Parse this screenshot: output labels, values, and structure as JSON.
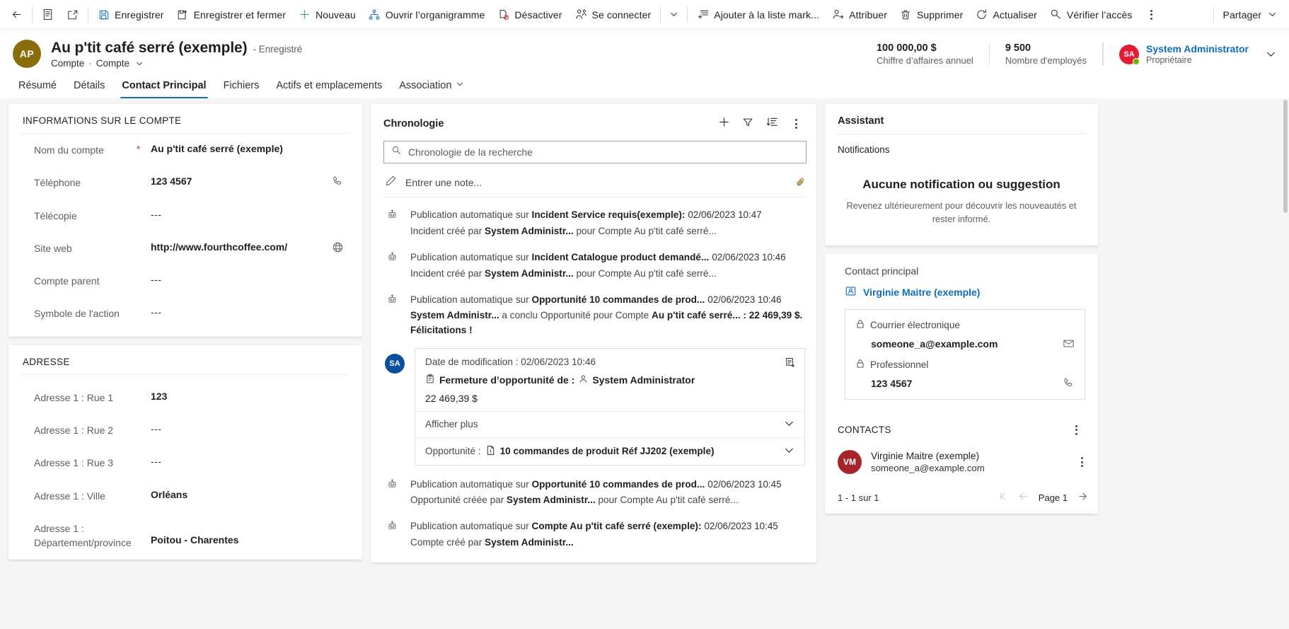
{
  "commandbar": {
    "back_label": "Retour",
    "form_selector_label": "Sélecteur de formulaire",
    "popout_label": "Ouvrir dans une nouvelle fenêtre",
    "items": [
      {
        "label": "Enregistrer",
        "icon": "save-icon"
      },
      {
        "label": "Enregistrer et fermer",
        "icon": "save-and-close-icon"
      },
      {
        "label": "Nouveau",
        "icon": "plus-icon"
      },
      {
        "label": "Ouvrir l’organigramme",
        "icon": "org-chart-icon"
      },
      {
        "label": "Désactiver",
        "icon": "deactivate-icon"
      },
      {
        "label": "Se connecter",
        "icon": "connect-icon"
      },
      {
        "label": "Ajouter à la liste mark...",
        "icon": "add-to-marketing-list-icon"
      },
      {
        "label": "Attribuer",
        "icon": "assign-icon"
      },
      {
        "label": "Supprimer",
        "icon": "delete-icon"
      },
      {
        "label": "Actualiser",
        "icon": "refresh-icon"
      },
      {
        "label": "Vérifier l’accès",
        "icon": "check-access-icon"
      }
    ],
    "overflow_label": "Plus de commandes",
    "share_label": "Partager"
  },
  "record": {
    "avatar_initials": "AP",
    "title": "Au p'tit café serré (exemple)",
    "status": "- Enregistré",
    "entity": "Compte",
    "form_name": "Compte",
    "stats": [
      {
        "value": "100 000,00 $",
        "label": "Chiffre d’affaires annuel"
      },
      {
        "value": "9 500",
        "label": "Nombre d'employés"
      }
    ],
    "owner": {
      "initials": "SA",
      "name": "System Administrator",
      "role": "Propriétaire"
    }
  },
  "tabs": [
    {
      "label": "Résumé",
      "active": false,
      "caret": false
    },
    {
      "label": "Détails",
      "active": false,
      "caret": false
    },
    {
      "label": "Contact Principal",
      "active": true,
      "caret": false
    },
    {
      "label": "Fichiers",
      "active": false,
      "caret": false
    },
    {
      "label": "Actifs et emplacements",
      "active": false,
      "caret": false
    },
    {
      "label": "Association",
      "active": false,
      "caret": true
    }
  ],
  "account_section": {
    "title": "INFORMATIONS SUR LE COMPTE",
    "fields": [
      {
        "label": "Nom du compte",
        "required": true,
        "value": "Au p'tit café serré (exemple)",
        "empty": false,
        "action_icon": ""
      },
      {
        "label": "Téléphone",
        "required": false,
        "value": "123 4567",
        "empty": false,
        "action_icon": "phone-icon"
      },
      {
        "label": "Télécopie",
        "required": false,
        "value": "---",
        "empty": true,
        "action_icon": ""
      },
      {
        "label": "Site web",
        "required": false,
        "value": "http://www.fourthcoffee.com/",
        "empty": false,
        "action_icon": "globe-icon"
      },
      {
        "label": "Compte parent",
        "required": false,
        "value": "---",
        "empty": true,
        "action_icon": ""
      },
      {
        "label": "Symbole de l'action",
        "required": false,
        "value": "---",
        "empty": true,
        "action_icon": ""
      }
    ]
  },
  "address_section": {
    "title": "ADRESSE",
    "fields": [
      {
        "label": "Adresse 1 : Rue 1",
        "required": false,
        "value": "123",
        "empty": false,
        "action_icon": ""
      },
      {
        "label": "Adresse 1 : Rue 2",
        "required": false,
        "value": "---",
        "empty": true,
        "action_icon": ""
      },
      {
        "label": "Adresse 1 : Rue 3",
        "required": false,
        "value": "---",
        "empty": true,
        "action_icon": ""
      },
      {
        "label": "Adresse 1 : Ville",
        "required": false,
        "value": "Orléans",
        "empty": false,
        "action_icon": ""
      },
      {
        "label": "Adresse 1 : Département/province",
        "required": false,
        "value": "Poitou - Charentes",
        "empty": false,
        "action_icon": ""
      }
    ]
  },
  "timeline": {
    "title": "Chronologie",
    "actions": [
      {
        "name": "create-timeline-record-button",
        "icon": "plus-icon"
      },
      {
        "name": "filter-button",
        "icon": "filter-icon"
      },
      {
        "name": "sort-button",
        "icon": "sort-icon"
      },
      {
        "name": "timeline-more-commands-button",
        "icon": "kebab-icon"
      }
    ],
    "search": {
      "placeholder": "Chronologie de la recherche",
      "value": ""
    },
    "note": {
      "placeholder": "Entrer une note...",
      "attach_icon": "paperclip-icon"
    },
    "entries": [
      {
        "kind": "post",
        "prefix": "Publication automatique sur ",
        "subject": "Incident Service requis(exemple):",
        "timestamp": "02/06/2023 10:47",
        "line2_pre": "Incident  créé par ",
        "line2_bold": "System Administr...",
        "line2_post": " pour Compte Au p'tit café serré...",
        "line2_tail": ""
      },
      {
        "kind": "post",
        "prefix": "Publication automatique sur ",
        "subject": "Incident Catalogue product demandé...",
        "timestamp": "02/06/2023 10:46",
        "line2_pre": "Incident  créé par ",
        "line2_bold": "System Administr...",
        "line2_post": " pour Compte Au p'tit café serré...",
        "line2_tail": ""
      },
      {
        "kind": "post",
        "prefix": "Publication automatique sur ",
        "subject": "Opportunité 10 commandes de prod...",
        "timestamp": "02/06/2023 10:46",
        "line2_pre": "",
        "line2_bold": "System Administr...",
        "line2_post": " a conclu Opportunité pour Compte ",
        "line2_tail": "Au p'tit café serré... : 22 469,39 $. Félicitations !"
      },
      {
        "kind": "card",
        "avatar_initials": "SA",
        "modified_label": "Date de modification : 02/06/2023 10:46",
        "subject_label": "Fermeture d’opportunité de :",
        "subject_person": "System Administrator",
        "amount": "22 469,39 $",
        "show_more": "Afficher plus",
        "oppty_label": "Opportunité :",
        "oppty_value": "10 commandes de produit Réf JJ202 (exemple)"
      },
      {
        "kind": "post",
        "prefix": "Publication automatique sur ",
        "subject": "Opportunité 10 commandes de prod...",
        "timestamp": "02/06/2023 10:45",
        "line2_pre": "Opportunité  créée par ",
        "line2_bold": "System Administr...",
        "line2_post": " pour Compte Au p'tit café serré...",
        "line2_tail": ""
      },
      {
        "kind": "post",
        "prefix": "Publication automatique sur ",
        "subject": "Compte Au p'tit café serré (exemple):",
        "timestamp": "02/06/2023 10:45",
        "line2_pre": "Compte  créé par ",
        "line2_bold": "System Administr...",
        "line2_post": "",
        "line2_tail": ""
      }
    ]
  },
  "assistant": {
    "title": "Assistant",
    "notifications_label": "Notifications",
    "empty_title": "Aucune notification ou suggestion",
    "empty_subtitle": "Revenez ultérieurement pour découvrir les nouveautés et rester informé."
  },
  "primary_contact": {
    "label": "Contact principal",
    "name": "Virginie Maitre (exemple)",
    "rows": [
      {
        "label": "Courrier électronique",
        "value": "someone_a@example.com",
        "lock_icon": "lock-icon",
        "action_icon": "mail-icon"
      },
      {
        "label": "Professionnel",
        "value": "123 4567",
        "lock_icon": "lock-icon",
        "action_icon": "phone-icon"
      }
    ]
  },
  "contacts": {
    "title": "CONTACTS",
    "rows": [
      {
        "initials": "VM",
        "name": "Virginie Maitre (exemple)",
        "email": "someone_a@example.com"
      }
    ],
    "footer_count": "1 - 1 sur 1",
    "page_label": "Page 1"
  },
  "colors": {
    "accent": "#0f6cbd",
    "avatar_record": "#8a6d0b",
    "avatar_owner": "#e31e34",
    "avatar_timeline": "#0b4f9e",
    "avatar_contact": "#a4262c",
    "required": "#a4262c"
  }
}
